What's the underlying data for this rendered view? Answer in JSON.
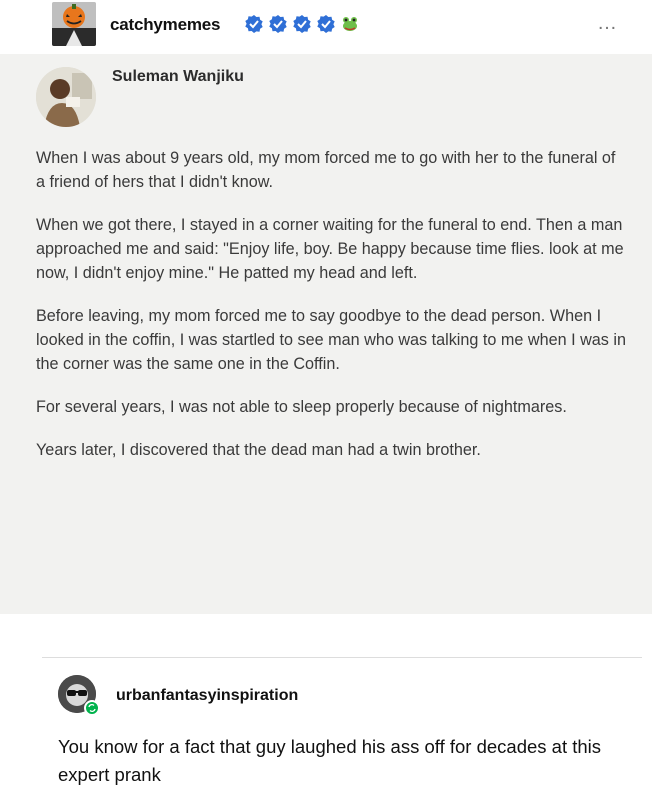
{
  "post": {
    "blogname": "catchymemes",
    "more_icon": "…",
    "badges": [
      "verified-check-icon",
      "verified-check-icon",
      "verified-check-icon",
      "verified-check-icon",
      "frog-sticker-icon"
    ],
    "colors": {
      "badge_blue": "#2f6fd6",
      "card_bg": "#f2f2f0"
    }
  },
  "embed": {
    "author": "Suleman Wanjiku",
    "paragraphs": [
      "When I was about 9 years old, my mom forced me to go with her to the funeral of a friend of hers that I didn't know.",
      "When we got there, I stayed in a corner waiting for the funeral to end. Then a man approached me and said: \"Enjoy life, boy. Be happy because time flies. look at me now, I didn't enjoy mine.\" He patted my head and left.",
      "Before leaving, my mom forced me to say goodbye to the dead person. When I looked in the coffin, I was startled to see man who was talking to me when I was in the corner was the same one in the Coffin.",
      "For several years, I was not able to sleep properly because of nightmares.",
      "Years later, I discovered that the dead man had a twin brother."
    ]
  },
  "reblog": {
    "blogname": "urbanfantasyinspiration",
    "text": "You know for a fact that guy laughed his ass off for decades at this expert prank",
    "colors": {
      "badge_green": "#00b24c"
    }
  }
}
